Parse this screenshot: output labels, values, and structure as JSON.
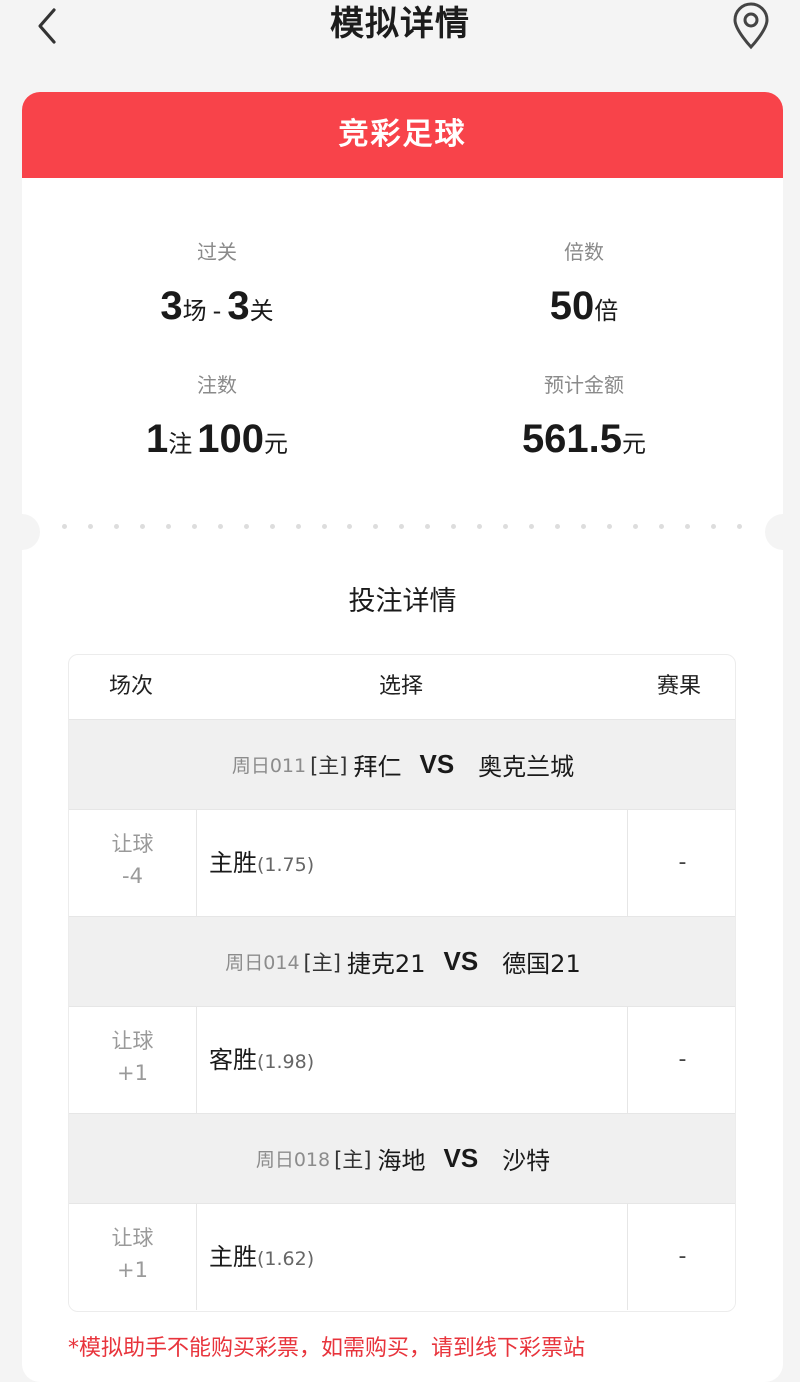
{
  "header": {
    "title": "模拟详情",
    "back_icon": "chevron-left-icon",
    "location_icon": "map-pin-icon"
  },
  "card": {
    "title": "竞彩足球",
    "accent_color": "#f8434a",
    "stats": {
      "pass": {
        "label": "过关",
        "matches": "3",
        "matches_unit": "场",
        "separator": "-",
        "levels": "3",
        "levels_unit": "关"
      },
      "multiple": {
        "label": "倍数",
        "value": "50",
        "unit": "倍"
      },
      "bets": {
        "label": "注数",
        "count": "1",
        "count_unit": "注",
        "amount": "100",
        "amount_unit": "元"
      },
      "estimated": {
        "label": "预计金额",
        "value": "561.5",
        "unit": "元"
      }
    }
  },
  "details": {
    "title": "投注详情",
    "columns": [
      "场次",
      "选择",
      "赛果"
    ],
    "matches": [
      {
        "code": "周日011",
        "home_tag": "[主]",
        "home": "拜仁",
        "vs": "VS",
        "away": "奥克兰城",
        "handicap_label": "让球",
        "handicap": "-4",
        "choice": "主胜",
        "odds": "(1.75)",
        "result": "-"
      },
      {
        "code": "周日014",
        "home_tag": "[主]",
        "home": "捷克21",
        "vs": "VS",
        "away": "德国21",
        "handicap_label": "让球",
        "handicap": "+1",
        "choice": "客胜",
        "odds": "(1.98)",
        "result": "-"
      },
      {
        "code": "周日018",
        "home_tag": "[主]",
        "home": "海地",
        "vs": "VS",
        "away": "沙特",
        "handicap_label": "让球",
        "handicap": "+1",
        "choice": "主胜",
        "odds": "(1.62)",
        "result": "-"
      }
    ]
  },
  "footnote": "*模拟助手不能购买彩票，如需购买，请到线下彩票站"
}
